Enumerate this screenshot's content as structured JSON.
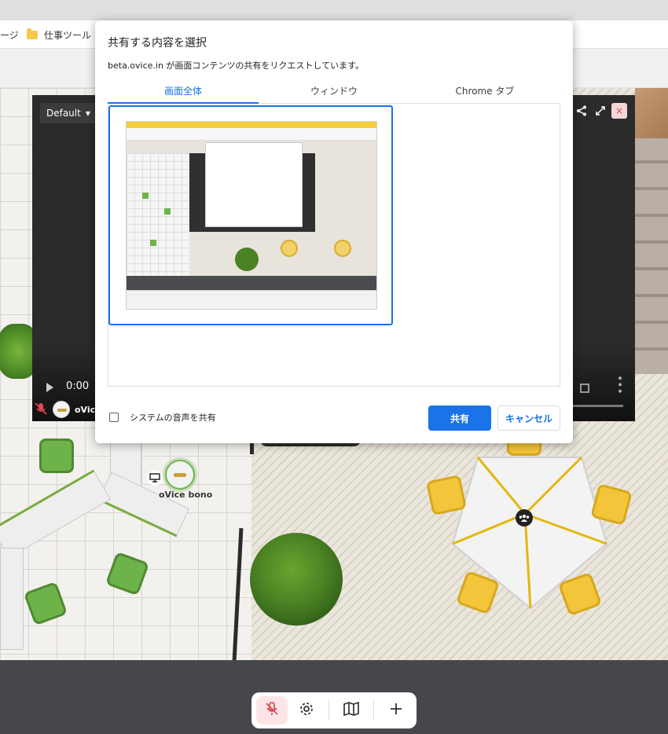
{
  "browser": {
    "bookmark_fragment": "ージ",
    "bookmark_folder_label": "仕事ツール"
  },
  "video": {
    "quality_label": "Default",
    "time": "0:00",
    "user_label": "oVic",
    "close_symbol": "×"
  },
  "dialog": {
    "title": "共有する内容を選択",
    "subtitle": "beta.ovice.in が画面コンテンツの共有をリクエストしています。",
    "tabs": [
      {
        "label": "画面全体",
        "active": true
      },
      {
        "label": "ウィンドウ",
        "active": false
      },
      {
        "label": "Chrome タブ",
        "active": false
      }
    ],
    "checkbox_label": "システムの音声を共有",
    "share_label": "共有",
    "cancel_label": "キャンセル"
  },
  "map": {
    "user_name": "oVice bono"
  },
  "toolbar": {
    "icons": [
      "mic-off-icon",
      "gear-icon",
      "map-icon",
      "plus-icon"
    ]
  },
  "colors": {
    "accent": "#1a73e8",
    "mic_off": "#e04a55",
    "footer": "#46474b"
  }
}
